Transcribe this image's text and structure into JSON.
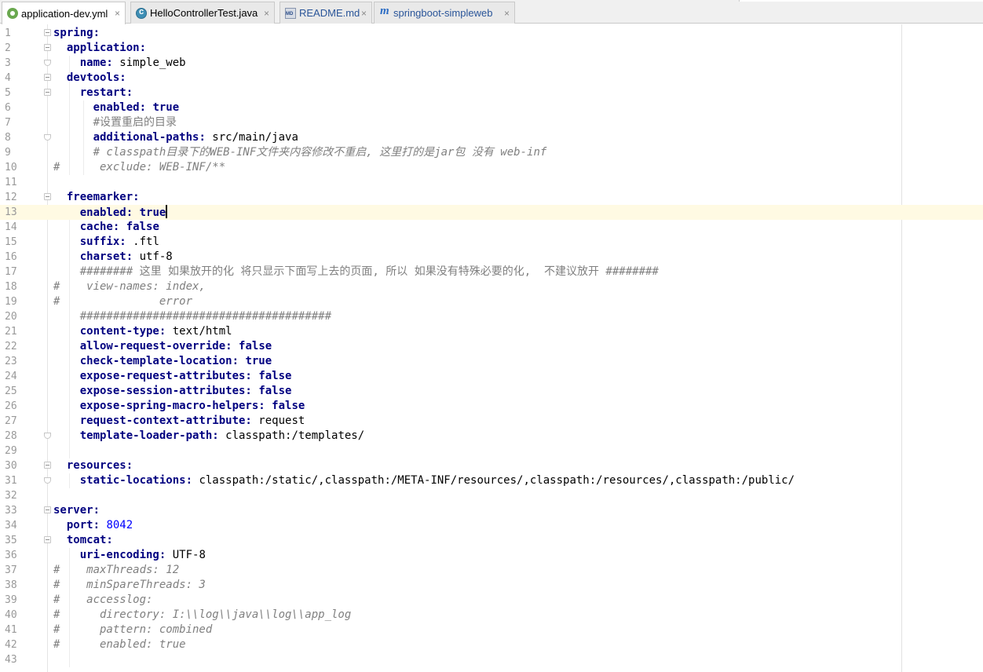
{
  "tabs": [
    {
      "label": "application-dev.yml",
      "icon": "yaml-file-icon",
      "active": true
    },
    {
      "label": "HelloControllerTest.java",
      "icon": "java-class-icon",
      "active": false
    },
    {
      "label": "README.md",
      "icon": "markdown-file-icon",
      "active": false
    },
    {
      "label": "springboot-simpleweb",
      "icon": "maven-module-icon",
      "active": false
    }
  ],
  "close_glyph": "×",
  "editor": {
    "current_line": 13,
    "lines": [
      {
        "n": "1",
        "fold": "open",
        "segs": [
          {
            "t": "spring:",
            "s": "k"
          }
        ]
      },
      {
        "n": "2",
        "fold": "open",
        "segs": [
          {
            "t": "  "
          },
          {
            "t": "application:",
            "s": "k"
          }
        ]
      },
      {
        "n": "3",
        "fold": "end",
        "segs": [
          {
            "t": "    "
          },
          {
            "t": "name:",
            "s": "k"
          },
          {
            "t": " simple_web",
            "s": "v"
          }
        ]
      },
      {
        "n": "4",
        "fold": "open",
        "segs": [
          {
            "t": "  "
          },
          {
            "t": "devtools:",
            "s": "k"
          }
        ]
      },
      {
        "n": "5",
        "fold": "open",
        "segs": [
          {
            "t": "    "
          },
          {
            "t": "restart:",
            "s": "k"
          }
        ]
      },
      {
        "n": "6",
        "fold": "",
        "segs": [
          {
            "t": "      "
          },
          {
            "t": "enabled:",
            "s": "k"
          },
          {
            "t": " "
          },
          {
            "t": "true",
            "s": "k"
          }
        ]
      },
      {
        "n": "7",
        "fold": "",
        "segs": [
          {
            "t": "      "
          },
          {
            "t": "#设置重启的目录",
            "s": "cn"
          }
        ]
      },
      {
        "n": "8",
        "fold": "end",
        "segs": [
          {
            "t": "      "
          },
          {
            "t": "additional-paths:",
            "s": "k"
          },
          {
            "t": " src/main/java",
            "s": "v"
          }
        ]
      },
      {
        "n": "9",
        "fold": "",
        "segs": [
          {
            "t": "      "
          },
          {
            "t": "# classpath目录下的WEB-INF文件夹内容修改不重启, 这里打的是jar包 没有 web-inf",
            "s": "c"
          }
        ]
      },
      {
        "n": "10",
        "fold": "",
        "segs": [
          {
            "t": "#      exclude: WEB-INF/**",
            "s": "c"
          }
        ]
      },
      {
        "n": "11",
        "fold": "",
        "segs": []
      },
      {
        "n": "12",
        "fold": "open",
        "segs": [
          {
            "t": "  "
          },
          {
            "t": "freemarker:",
            "s": "k"
          }
        ]
      },
      {
        "n": "13",
        "fold": "",
        "segs": [
          {
            "t": "    "
          },
          {
            "t": "enabled:",
            "s": "k"
          },
          {
            "t": " "
          },
          {
            "t": "true",
            "s": "k"
          }
        ],
        "caret": true
      },
      {
        "n": "14",
        "fold": "",
        "segs": [
          {
            "t": "    "
          },
          {
            "t": "cache:",
            "s": "k"
          },
          {
            "t": " "
          },
          {
            "t": "false",
            "s": "k"
          }
        ]
      },
      {
        "n": "15",
        "fold": "",
        "segs": [
          {
            "t": "    "
          },
          {
            "t": "suffix:",
            "s": "k"
          },
          {
            "t": " .ftl",
            "s": "v"
          }
        ]
      },
      {
        "n": "16",
        "fold": "",
        "segs": [
          {
            "t": "    "
          },
          {
            "t": "charset:",
            "s": "k"
          },
          {
            "t": " utf-8",
            "s": "v"
          }
        ]
      },
      {
        "n": "17",
        "fold": "",
        "segs": [
          {
            "t": "    "
          },
          {
            "t": "######## 这里 如果放开的化 将只显示下面写上去的页面, 所以 如果没有特殊必要的化,  不建议放开 ########",
            "s": "cn"
          }
        ]
      },
      {
        "n": "18",
        "fold": "",
        "segs": [
          {
            "t": "#    view-names: index,",
            "s": "c"
          }
        ]
      },
      {
        "n": "19",
        "fold": "",
        "segs": [
          {
            "t": "#               error",
            "s": "c"
          }
        ]
      },
      {
        "n": "20",
        "fold": "",
        "segs": [
          {
            "t": "    "
          },
          {
            "t": "######################################",
            "s": "cn"
          }
        ]
      },
      {
        "n": "21",
        "fold": "",
        "segs": [
          {
            "t": "    "
          },
          {
            "t": "content-type:",
            "s": "k"
          },
          {
            "t": " text/html",
            "s": "v"
          }
        ]
      },
      {
        "n": "22",
        "fold": "",
        "segs": [
          {
            "t": "    "
          },
          {
            "t": "allow-request-override:",
            "s": "k"
          },
          {
            "t": " "
          },
          {
            "t": "false",
            "s": "k"
          }
        ]
      },
      {
        "n": "23",
        "fold": "",
        "segs": [
          {
            "t": "    "
          },
          {
            "t": "check-template-location:",
            "s": "k"
          },
          {
            "t": " "
          },
          {
            "t": "true",
            "s": "k"
          }
        ]
      },
      {
        "n": "24",
        "fold": "",
        "segs": [
          {
            "t": "    "
          },
          {
            "t": "expose-request-attributes:",
            "s": "k"
          },
          {
            "t": " "
          },
          {
            "t": "false",
            "s": "k"
          }
        ]
      },
      {
        "n": "25",
        "fold": "",
        "segs": [
          {
            "t": "    "
          },
          {
            "t": "expose-session-attributes:",
            "s": "k"
          },
          {
            "t": " "
          },
          {
            "t": "false",
            "s": "k"
          }
        ]
      },
      {
        "n": "26",
        "fold": "",
        "segs": [
          {
            "t": "    "
          },
          {
            "t": "expose-spring-macro-helpers:",
            "s": "k"
          },
          {
            "t": " "
          },
          {
            "t": "false",
            "s": "k"
          }
        ]
      },
      {
        "n": "27",
        "fold": "",
        "segs": [
          {
            "t": "    "
          },
          {
            "t": "request-context-attribute:",
            "s": "k"
          },
          {
            "t": " request",
            "s": "v"
          }
        ]
      },
      {
        "n": "28",
        "fold": "end",
        "segs": [
          {
            "t": "    "
          },
          {
            "t": "template-loader-path:",
            "s": "k"
          },
          {
            "t": " classpath:/templates/",
            "s": "v"
          }
        ]
      },
      {
        "n": "29",
        "fold": "",
        "segs": []
      },
      {
        "n": "30",
        "fold": "open",
        "segs": [
          {
            "t": "  "
          },
          {
            "t": "resources:",
            "s": "k"
          }
        ]
      },
      {
        "n": "31",
        "fold": "end",
        "segs": [
          {
            "t": "    "
          },
          {
            "t": "static-locations:",
            "s": "k"
          },
          {
            "t": " classpath:/static/,classpath:/META-INF/resources/,classpath:/resources/,classpath:/public/",
            "s": "v"
          }
        ]
      },
      {
        "n": "32",
        "fold": "",
        "segs": []
      },
      {
        "n": "33",
        "fold": "open",
        "segs": [
          {
            "t": "server:",
            "s": "k"
          }
        ]
      },
      {
        "n": "34",
        "fold": "",
        "segs": [
          {
            "t": "  "
          },
          {
            "t": "port:",
            "s": "k"
          },
          {
            "t": " "
          },
          {
            "t": "8042",
            "s": "n"
          }
        ]
      },
      {
        "n": "35",
        "fold": "open",
        "segs": [
          {
            "t": "  "
          },
          {
            "t": "tomcat:",
            "s": "k"
          }
        ]
      },
      {
        "n": "36",
        "fold": "",
        "segs": [
          {
            "t": "    "
          },
          {
            "t": "uri-encoding:",
            "s": "k"
          },
          {
            "t": " UTF-8",
            "s": "v"
          }
        ]
      },
      {
        "n": "37",
        "fold": "",
        "segs": [
          {
            "t": "#    maxThreads: 12",
            "s": "c"
          }
        ]
      },
      {
        "n": "38",
        "fold": "",
        "segs": [
          {
            "t": "#    minSpareThreads: 3",
            "s": "c"
          }
        ]
      },
      {
        "n": "39",
        "fold": "",
        "segs": [
          {
            "t": "#    accesslog:",
            "s": "c"
          }
        ]
      },
      {
        "n": "40",
        "fold": "",
        "segs": [
          {
            "t": "#      directory: I:\\\\log\\\\java\\\\log\\\\app_log",
            "s": "c"
          }
        ]
      },
      {
        "n": "41",
        "fold": "",
        "segs": [
          {
            "t": "#      pattern: combined",
            "s": "c"
          }
        ]
      },
      {
        "n": "42",
        "fold": "",
        "segs": [
          {
            "t": "#      enabled: true",
            "s": "c"
          }
        ]
      },
      {
        "n": "43",
        "fold": "",
        "segs": []
      }
    ]
  },
  "colors": {
    "key": "#000080",
    "comment": "#808080",
    "number": "#0000ff",
    "current_line_bg": "#fffae3"
  }
}
